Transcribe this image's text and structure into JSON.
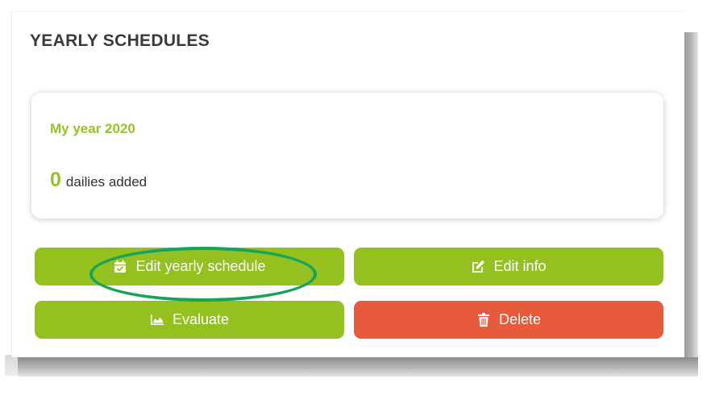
{
  "panel": {
    "title": "YEARLY SCHEDULES"
  },
  "schedule_card": {
    "name": "My year 2020",
    "dailies_count": "0",
    "dailies_label": "dailies added"
  },
  "actions": {
    "edit_schedule_label": "Edit yearly schedule",
    "edit_schedule_icon": "calendar-check-icon",
    "edit_info_label": "Edit info",
    "edit_info_icon": "edit-pencil-icon",
    "evaluate_label": "Evaluate",
    "evaluate_icon": "area-chart-icon",
    "delete_label": "Delete",
    "delete_icon": "trash-icon"
  },
  "colors": {
    "accent_green": "#94c11f",
    "title_green": "#99c22a",
    "danger_red": "#e85a3c",
    "highlight_ring": "#16a35a"
  }
}
